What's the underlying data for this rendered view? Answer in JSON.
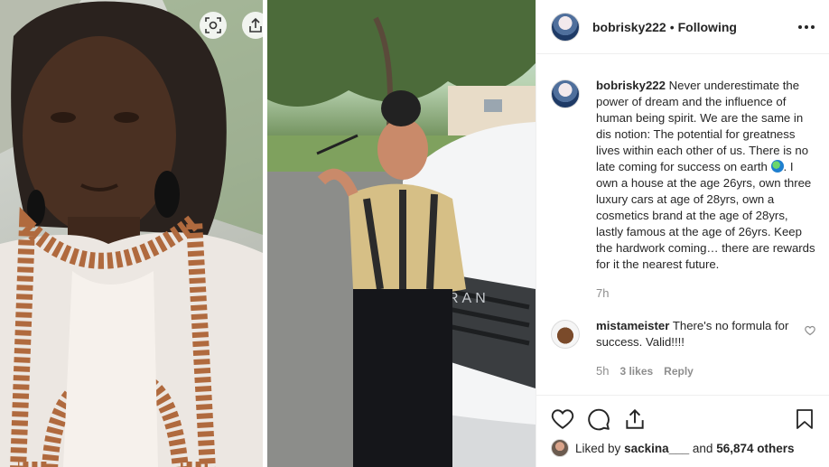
{
  "post": {
    "username": "bobrisky222",
    "separator": "•",
    "follow_status": "Following"
  },
  "caption": {
    "username": "bobrisky222",
    "text_part1": "Never underestimate the power of dream and the influence of human being spirit. We are the same in dis notion: The potential for greatness lives within each other of us. There is no late coming for success on earth",
    "emoji": "earth-globe-emoji",
    "text_part2": ". I own a house at the age 26yrs, own three luxury cars at age of 28yrs, own a cosmetics brand at the age of 28yrs, lastly famous at the age of 26yrs. Keep the hardwork coming… there are rewards for it the nearest future.",
    "time": "7h"
  },
  "comments": [
    {
      "username": "mistameister",
      "text": "There's no formula for success. Valid!!!!",
      "time": "5h",
      "likes": "3 likes",
      "reply_label": "Reply"
    }
  ],
  "likes": {
    "prefix": "Liked by",
    "user": "sackina___",
    "connector": "and",
    "others": "56,874 others"
  },
  "icons": [
    "lens-scan-icon",
    "share-upload-icon",
    "more-dots-icon",
    "heart-icon",
    "comment-icon",
    "share-icon",
    "bookmark-icon",
    "small-heart-icon"
  ],
  "colors": {
    "text": "#262626",
    "secondary": "#8e8e8e",
    "border": "#efefef"
  }
}
